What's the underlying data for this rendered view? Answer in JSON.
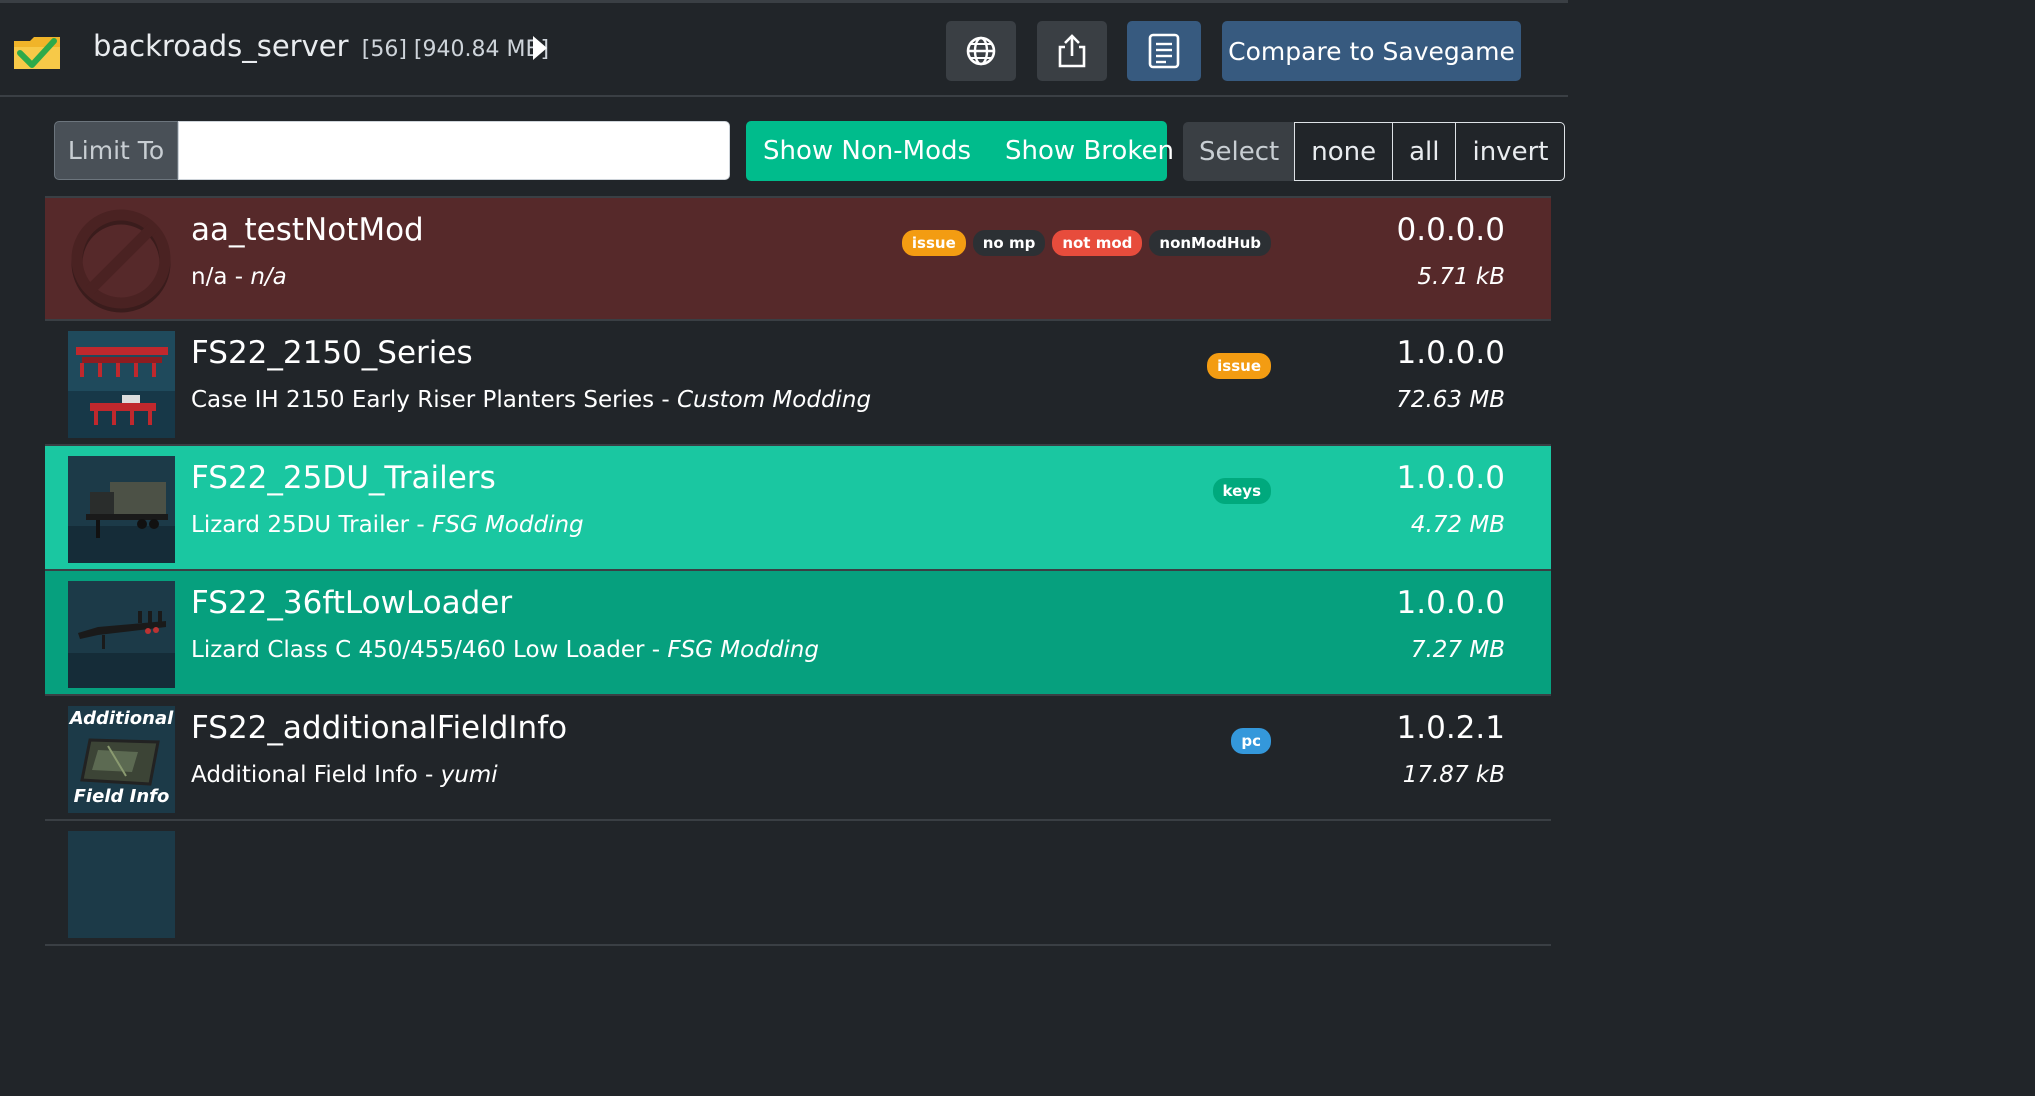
{
  "header": {
    "collection_name": "backroads_server",
    "collection_meta": "[56] [940.84 MB]",
    "compare_label": "Compare to Savegame",
    "icons": [
      "folder-check-icon",
      "play-icon",
      "globe-icon",
      "share-icon",
      "notes-icon"
    ]
  },
  "filter": {
    "limit_label": "Limit To",
    "limit_value": "",
    "show_non_mods": "Show Non-Mods",
    "show_broken": "Show Broken",
    "select_label": "Select",
    "select_none": "none",
    "select_all": "all",
    "select_invert": "invert"
  },
  "colors": {
    "background": "#212529",
    "broken_row": "#56292a",
    "selected_row_light": "#1ac7a1",
    "selected_row_dark": "#06a07e",
    "accent_green": "#00bc8c",
    "accent_blue": "#375a7f"
  },
  "mods": [
    {
      "name": "aa_testNotMod",
      "title": "n/a",
      "author": "n/a",
      "version": "0.0.0.0",
      "size": "5.71 kB",
      "badges": [
        "issue",
        "no mp",
        "not mod",
        "nonModHub"
      ],
      "state": "broken"
    },
    {
      "name": "FS22_2150_Series",
      "title": "Case IH 2150 Early Riser Planters Series",
      "author": "Custom Modding",
      "version": "1.0.0.0",
      "size": "72.63 MB",
      "badges": [
        "issue"
      ],
      "state": "normal"
    },
    {
      "name": "FS22_25DU_Trailers",
      "title": "Lizard 25DU Trailer",
      "author": "FSG Modding",
      "version": "1.0.0.0",
      "size": "4.72 MB",
      "badges": [
        "keys"
      ],
      "state": "selected-light"
    },
    {
      "name": "FS22_36ftLowLoader",
      "title": "Lizard Class C 450/455/460 Low Loader",
      "author": "FSG Modding",
      "version": "1.0.0.0",
      "size": "7.27 MB",
      "badges": [],
      "state": "selected-dark"
    },
    {
      "name": "FS22_additionalFieldInfo",
      "title": "Additional Field Info",
      "author": "yumi",
      "version": "1.0.2.1",
      "size": "17.87 kB",
      "badges": [
        "pc"
      ],
      "state": "normal",
      "thumb_text_top": "Additional",
      "thumb_text_bottom": "Field Info"
    }
  ]
}
